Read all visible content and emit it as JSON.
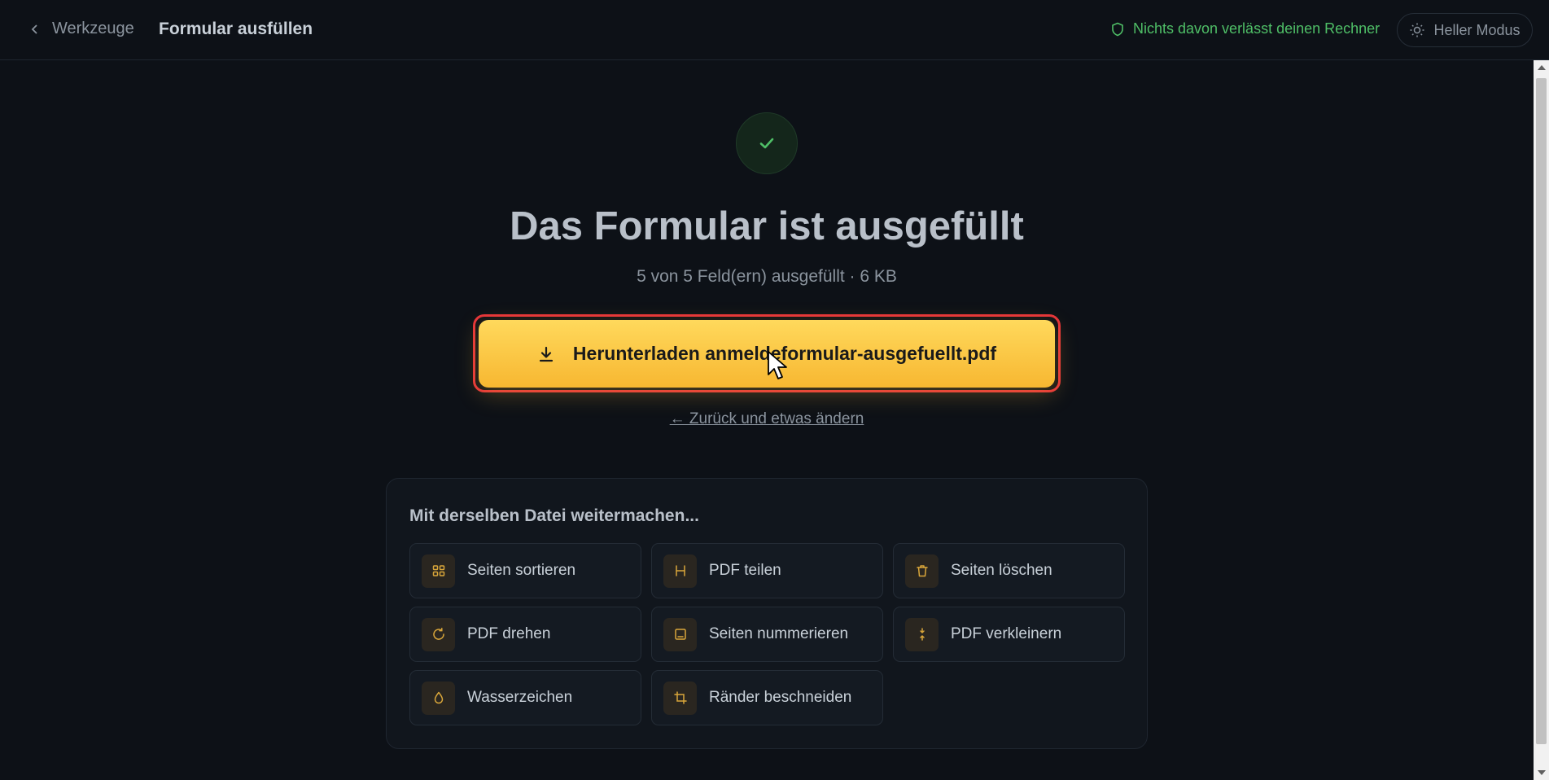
{
  "header": {
    "back_label": "Werkzeuge",
    "title": "Formular ausfüllen",
    "privacy_note": "Nichts davon verlässt deinen Rechner",
    "mode_toggle": "Heller Modus"
  },
  "result": {
    "headline": "Das Formular ist ausgefüllt",
    "summary": "5 von 5 Feld(ern) ausgefüllt · 6 KB",
    "download_label": "Herunterladen anmeldeformular-ausgefuellt.pdf",
    "change_link": "← Zurück und etwas ändern"
  },
  "continue": {
    "title": "Mit derselben Datei weitermachen...",
    "tools": [
      {
        "label": "Seiten sortieren",
        "icon": "grid-icon"
      },
      {
        "label": "PDF teilen",
        "icon": "split-icon"
      },
      {
        "label": "Seiten löschen",
        "icon": "trash-icon"
      },
      {
        "label": "PDF drehen",
        "icon": "rotate-icon"
      },
      {
        "label": "Seiten nummerieren",
        "icon": "page-number-icon"
      },
      {
        "label": "PDF verkleinern",
        "icon": "compress-icon"
      },
      {
        "label": "Wasserzeichen",
        "icon": "droplet-icon"
      },
      {
        "label": "Ränder beschneiden",
        "icon": "crop-icon"
      }
    ]
  },
  "colors": {
    "background": "#0d1117",
    "accent": "#f7b731",
    "success": "#4fbf67",
    "focus_ring": "#e5343a"
  }
}
